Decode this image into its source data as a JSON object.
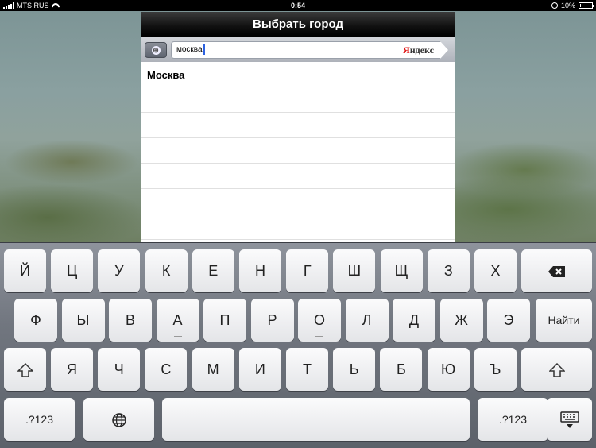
{
  "status_bar": {
    "carrier": "MTS RUS",
    "time": "0:54",
    "battery": "10%",
    "battery_level": 0.1
  },
  "popover": {
    "title": "Выбрать город"
  },
  "search": {
    "query": "москва",
    "provider": "Яндекс"
  },
  "results": [
    "Москва",
    "",
    "",
    "",
    "",
    "",
    ""
  ],
  "keyboard": {
    "row1": [
      "Й",
      "Ц",
      "У",
      "К",
      "Е",
      "Н",
      "Г",
      "Ш",
      "Щ",
      "З",
      "Х"
    ],
    "row2": [
      "Ф",
      "Ы",
      "В",
      "А",
      "П",
      "Р",
      "О",
      "Л",
      "Д",
      "Ж",
      "Э"
    ],
    "row3": [
      "Я",
      "Ч",
      "С",
      "М",
      "И",
      "Т",
      "Ь",
      "Б",
      "Ю",
      "Ъ"
    ],
    "go_label": "Найти",
    "numbers_label": ".?123"
  }
}
